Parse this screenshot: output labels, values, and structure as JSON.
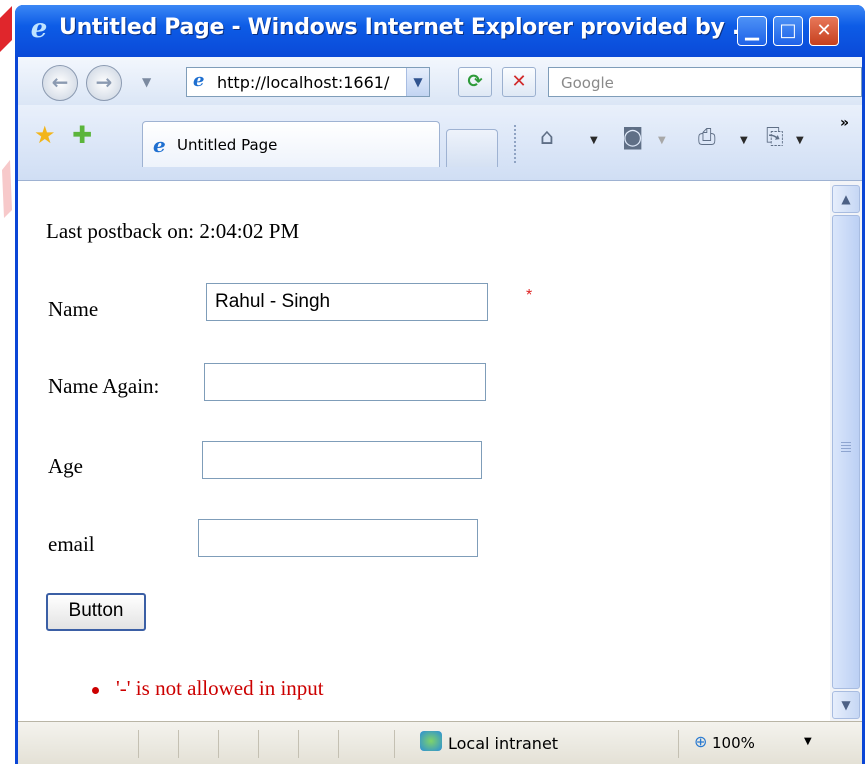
{
  "window": {
    "title": "Untitled Page - Windows Internet Explorer provided by ...",
    "minimize_glyph": "▁",
    "maximize_glyph": "□",
    "close_glyph": "✕"
  },
  "nav": {
    "back_glyph": "←",
    "forward_glyph": "→",
    "dropdown_glyph": "▼",
    "address": "http://localhost:1661/",
    "address_dropdown_glyph": "▼",
    "refresh_glyph": "⟳",
    "stop_glyph": "✕",
    "search_placeholder": "Google"
  },
  "tabs": {
    "active_label": "Untitled Page",
    "more_glyph": "»"
  },
  "icons": {
    "favorites": "★",
    "add_favorites": "✚",
    "home": "⌂",
    "feeds": "◙",
    "print": "⎙",
    "page": "⎘",
    "dropdown": "▼"
  },
  "page": {
    "postback_label": "Last postback on: 2:04:02 PM",
    "name_label": "Name",
    "name_value": "Rahul - Singh",
    "required_marker": "*",
    "name_again_label": "Name Again:",
    "name_again_value": "",
    "age_label": "Age",
    "age_value": "",
    "email_label": "email",
    "email_value": "",
    "button_label": "Button",
    "error_message": "'-' is not allowed in input"
  },
  "scrollbar": {
    "up_glyph": "▲",
    "down_glyph": "▼"
  },
  "status": {
    "zone": "Local intranet",
    "zoom_glyph": "⊕",
    "zoom": "100%",
    "zoom_dropdown_glyph": "▼"
  },
  "colors": {
    "titlebar": "#0a49d8",
    "error_red": "#cc0000",
    "required_red": "#dd2222"
  }
}
